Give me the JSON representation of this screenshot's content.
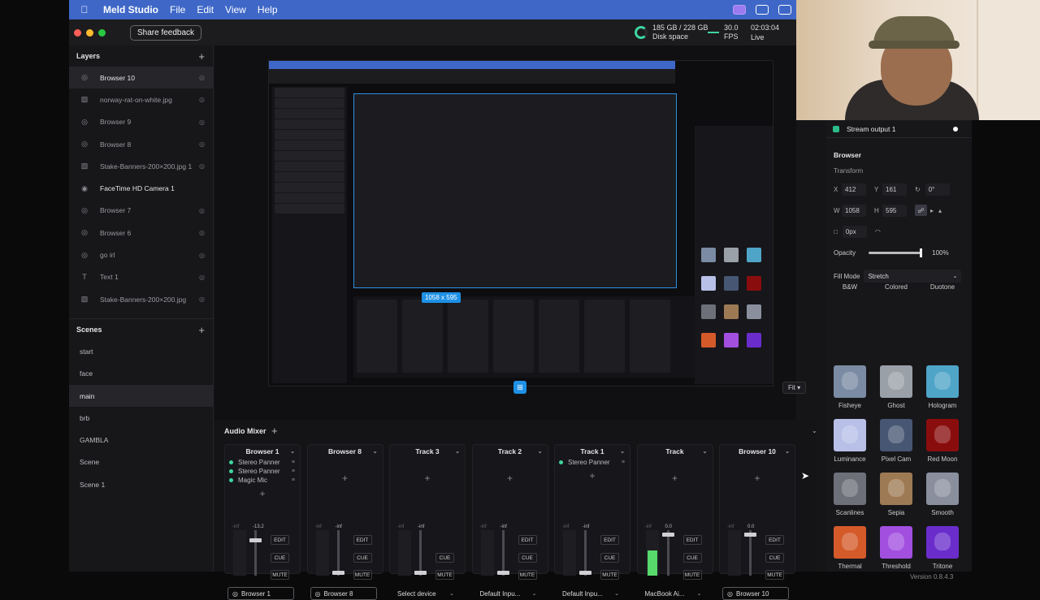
{
  "menubar": {
    "app": "Meld Studio",
    "items": [
      "File",
      "Edit",
      "View",
      "Help"
    ]
  },
  "titlebar": {
    "share": "Share feedback",
    "disk_value": "185 GB / 228 GB",
    "disk_label": "Disk space",
    "fps_value": "30.0",
    "fps_label": "FPS",
    "live_time": "02:03:04",
    "live_label": "Live"
  },
  "layers": {
    "title": "Layers",
    "items": [
      {
        "label": "Browser 10",
        "icon": "globe-icon"
      },
      {
        "label": "norway-rat-on-white.jpg",
        "icon": "image-icon"
      },
      {
        "label": "Browser 9",
        "icon": "globe-icon"
      },
      {
        "label": "Browser 8",
        "icon": "globe-icon"
      },
      {
        "label": "Stake-Banners-200×200.jpg 1",
        "icon": "image-icon"
      },
      {
        "label": "FaceTime HD Camera 1",
        "icon": "camera-icon"
      },
      {
        "label": "Browser 7",
        "icon": "globe-icon"
      },
      {
        "label": "Browser 6",
        "icon": "globe-icon"
      },
      {
        "label": "go irl",
        "icon": "globe-icon"
      },
      {
        "label": "Text 1",
        "icon": "text-icon"
      },
      {
        "label": "Stake-Banners-200×200.jpg",
        "icon": "image-icon"
      }
    ]
  },
  "scenes": {
    "title": "Scenes",
    "items": [
      "start",
      "face",
      "main",
      "brb",
      "GAMBLA",
      "Scene",
      "Scene 1"
    ]
  },
  "canvas": {
    "size_tag": "1058 x 595",
    "fit": "Fit"
  },
  "mixer": {
    "title": "Audio Mixer",
    "strips": [
      {
        "name": "Browser 1",
        "fx": [
          "Stereo Panner",
          "Stereo Panner",
          "Magic Mic"
        ],
        "db": "-13.2",
        "device": "Browser 1",
        "has_edit": true,
        "level": 0
      },
      {
        "name": "Browser 8",
        "fx": [],
        "db": "-inf",
        "device": "Browser 8",
        "has_edit": true,
        "level": 0
      },
      {
        "name": "Track 3",
        "fx": [],
        "db": "-inf",
        "device": "Select device",
        "has_edit": false,
        "level": 0
      },
      {
        "name": "Track 2",
        "fx": [],
        "db": "-inf",
        "device": "Default Inpu...",
        "has_edit": true,
        "level": 0
      },
      {
        "name": "Track 1",
        "fx": [
          "Stereo Panner"
        ],
        "db": "-inf",
        "device": "Default Inpu...",
        "has_edit": true,
        "level": 0
      },
      {
        "name": "Track",
        "fx": [],
        "db": "0.0",
        "device": "MacBook Ai...",
        "has_edit": true,
        "level": 0.55
      },
      {
        "name": "Browser 10",
        "fx": [],
        "db": "0.0",
        "device": "Browser 10",
        "has_edit": true,
        "level": 0
      }
    ],
    "buttons": {
      "edit": "EDIT",
      "cue": "CUE",
      "mute": "MUTE"
    }
  },
  "right_panel": {
    "output": "Stream output 1",
    "section": "Browser",
    "transform": "Transform",
    "x": "412",
    "y": "161",
    "rotation": "0°",
    "w": "1058",
    "h": "595",
    "radius": "0px",
    "opacity_label": "Opacity",
    "opacity_value": "100%",
    "opacity_level": 1.0,
    "fill_mode_label": "Fill Mode",
    "fill_mode": "Stretch",
    "effects": [
      {
        "name": "B&W",
        "color": "#555"
      },
      {
        "name": "Colored",
        "color": "#6d3fbf"
      },
      {
        "name": "Duotone",
        "color": "#5a2ea8"
      },
      {
        "name": "Fisheye",
        "color": "#7a8ba3"
      },
      {
        "name": "Ghost",
        "color": "#9aa0a8"
      },
      {
        "name": "Hologram",
        "color": "#4fa5c8"
      },
      {
        "name": "Luminance",
        "color": "#b8c0e8"
      },
      {
        "name": "Pixel Cam",
        "color": "#475672"
      },
      {
        "name": "Red Moon",
        "color": "#8a0d0d"
      },
      {
        "name": "Scanlines",
        "color": "#6d7079"
      },
      {
        "name": "Sepia",
        "color": "#9e7a54"
      },
      {
        "name": "Smooth",
        "color": "#8a8f9e"
      },
      {
        "name": "Thermal",
        "color": "#d45a2a"
      },
      {
        "name": "Threshold",
        "color": "#a24fe0"
      },
      {
        "name": "Tritone",
        "color": "#6a2dcc"
      }
    ],
    "version": "Version 0.8.4.3"
  }
}
